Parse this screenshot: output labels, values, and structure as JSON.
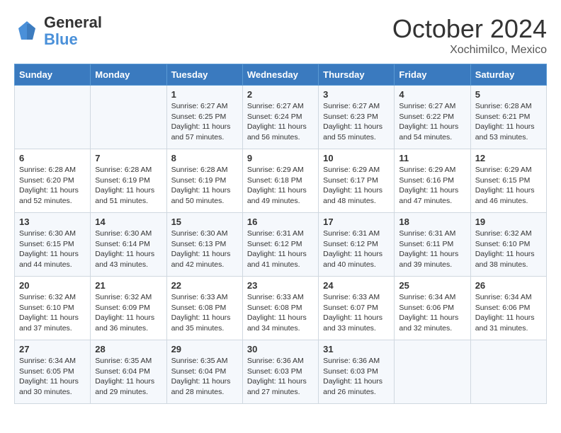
{
  "header": {
    "logo_line1": "General",
    "logo_line2": "Blue",
    "month": "October 2024",
    "location": "Xochimilco, Mexico"
  },
  "days_of_week": [
    "Sunday",
    "Monday",
    "Tuesday",
    "Wednesday",
    "Thursday",
    "Friday",
    "Saturday"
  ],
  "weeks": [
    [
      {
        "day": "",
        "info": ""
      },
      {
        "day": "",
        "info": ""
      },
      {
        "day": "1",
        "info": "Sunrise: 6:27 AM\nSunset: 6:25 PM\nDaylight: 11 hours and 57 minutes."
      },
      {
        "day": "2",
        "info": "Sunrise: 6:27 AM\nSunset: 6:24 PM\nDaylight: 11 hours and 56 minutes."
      },
      {
        "day": "3",
        "info": "Sunrise: 6:27 AM\nSunset: 6:23 PM\nDaylight: 11 hours and 55 minutes."
      },
      {
        "day": "4",
        "info": "Sunrise: 6:27 AM\nSunset: 6:22 PM\nDaylight: 11 hours and 54 minutes."
      },
      {
        "day": "5",
        "info": "Sunrise: 6:28 AM\nSunset: 6:21 PM\nDaylight: 11 hours and 53 minutes."
      }
    ],
    [
      {
        "day": "6",
        "info": "Sunrise: 6:28 AM\nSunset: 6:20 PM\nDaylight: 11 hours and 52 minutes."
      },
      {
        "day": "7",
        "info": "Sunrise: 6:28 AM\nSunset: 6:19 PM\nDaylight: 11 hours and 51 minutes."
      },
      {
        "day": "8",
        "info": "Sunrise: 6:28 AM\nSunset: 6:19 PM\nDaylight: 11 hours and 50 minutes."
      },
      {
        "day": "9",
        "info": "Sunrise: 6:29 AM\nSunset: 6:18 PM\nDaylight: 11 hours and 49 minutes."
      },
      {
        "day": "10",
        "info": "Sunrise: 6:29 AM\nSunset: 6:17 PM\nDaylight: 11 hours and 48 minutes."
      },
      {
        "day": "11",
        "info": "Sunrise: 6:29 AM\nSunset: 6:16 PM\nDaylight: 11 hours and 47 minutes."
      },
      {
        "day": "12",
        "info": "Sunrise: 6:29 AM\nSunset: 6:15 PM\nDaylight: 11 hours and 46 minutes."
      }
    ],
    [
      {
        "day": "13",
        "info": "Sunrise: 6:30 AM\nSunset: 6:15 PM\nDaylight: 11 hours and 44 minutes."
      },
      {
        "day": "14",
        "info": "Sunrise: 6:30 AM\nSunset: 6:14 PM\nDaylight: 11 hours and 43 minutes."
      },
      {
        "day": "15",
        "info": "Sunrise: 6:30 AM\nSunset: 6:13 PM\nDaylight: 11 hours and 42 minutes."
      },
      {
        "day": "16",
        "info": "Sunrise: 6:31 AM\nSunset: 6:12 PM\nDaylight: 11 hours and 41 minutes."
      },
      {
        "day": "17",
        "info": "Sunrise: 6:31 AM\nSunset: 6:12 PM\nDaylight: 11 hours and 40 minutes."
      },
      {
        "day": "18",
        "info": "Sunrise: 6:31 AM\nSunset: 6:11 PM\nDaylight: 11 hours and 39 minutes."
      },
      {
        "day": "19",
        "info": "Sunrise: 6:32 AM\nSunset: 6:10 PM\nDaylight: 11 hours and 38 minutes."
      }
    ],
    [
      {
        "day": "20",
        "info": "Sunrise: 6:32 AM\nSunset: 6:10 PM\nDaylight: 11 hours and 37 minutes."
      },
      {
        "day": "21",
        "info": "Sunrise: 6:32 AM\nSunset: 6:09 PM\nDaylight: 11 hours and 36 minutes."
      },
      {
        "day": "22",
        "info": "Sunrise: 6:33 AM\nSunset: 6:08 PM\nDaylight: 11 hours and 35 minutes."
      },
      {
        "day": "23",
        "info": "Sunrise: 6:33 AM\nSunset: 6:08 PM\nDaylight: 11 hours and 34 minutes."
      },
      {
        "day": "24",
        "info": "Sunrise: 6:33 AM\nSunset: 6:07 PM\nDaylight: 11 hours and 33 minutes."
      },
      {
        "day": "25",
        "info": "Sunrise: 6:34 AM\nSunset: 6:06 PM\nDaylight: 11 hours and 32 minutes."
      },
      {
        "day": "26",
        "info": "Sunrise: 6:34 AM\nSunset: 6:06 PM\nDaylight: 11 hours and 31 minutes."
      }
    ],
    [
      {
        "day": "27",
        "info": "Sunrise: 6:34 AM\nSunset: 6:05 PM\nDaylight: 11 hours and 30 minutes."
      },
      {
        "day": "28",
        "info": "Sunrise: 6:35 AM\nSunset: 6:04 PM\nDaylight: 11 hours and 29 minutes."
      },
      {
        "day": "29",
        "info": "Sunrise: 6:35 AM\nSunset: 6:04 PM\nDaylight: 11 hours and 28 minutes."
      },
      {
        "day": "30",
        "info": "Sunrise: 6:36 AM\nSunset: 6:03 PM\nDaylight: 11 hours and 27 minutes."
      },
      {
        "day": "31",
        "info": "Sunrise: 6:36 AM\nSunset: 6:03 PM\nDaylight: 11 hours and 26 minutes."
      },
      {
        "day": "",
        "info": ""
      },
      {
        "day": "",
        "info": ""
      }
    ]
  ]
}
